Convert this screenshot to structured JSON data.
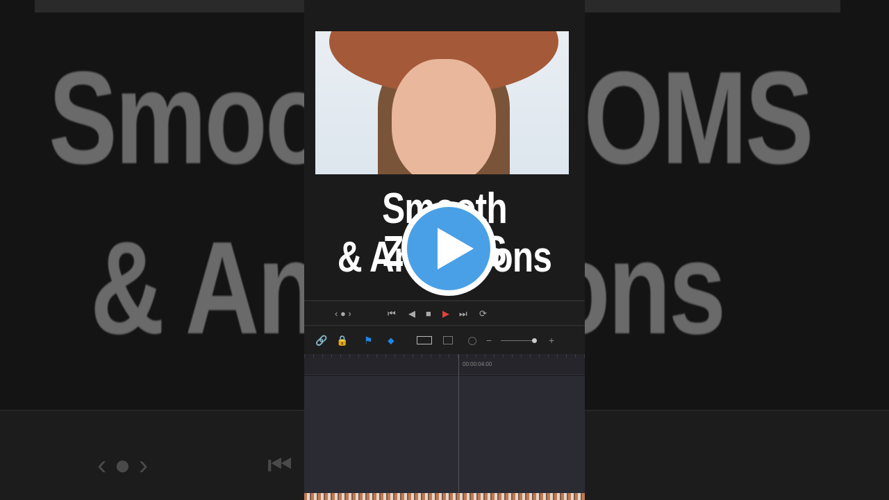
{
  "thumbnail": {
    "title_line1": "Smooth ZOOMS",
    "title_line2": "& Animations"
  },
  "background": {
    "text_line1": "Smooth ZOOMS",
    "text_line2": "& Animations"
  },
  "transport": {
    "nav": "‹ ● ›",
    "skip_back": "⏮",
    "back": "◀",
    "stop": "■",
    "play": "▶",
    "skip_forward": "⏭",
    "loop": "⟳"
  },
  "toolbar": {
    "link": "🔗",
    "lock": "🔒",
    "flag": "⚑",
    "marker": "⬥",
    "zoom_minus": "−",
    "zoom_plus": "+",
    "zoom_level": 0.85
  },
  "timeline": {
    "timecode": "00:00:04:00"
  },
  "colors": {
    "play_button": "#4aa0e6",
    "play_red": "#e0443a",
    "flag_blue": "#1e88e5"
  }
}
